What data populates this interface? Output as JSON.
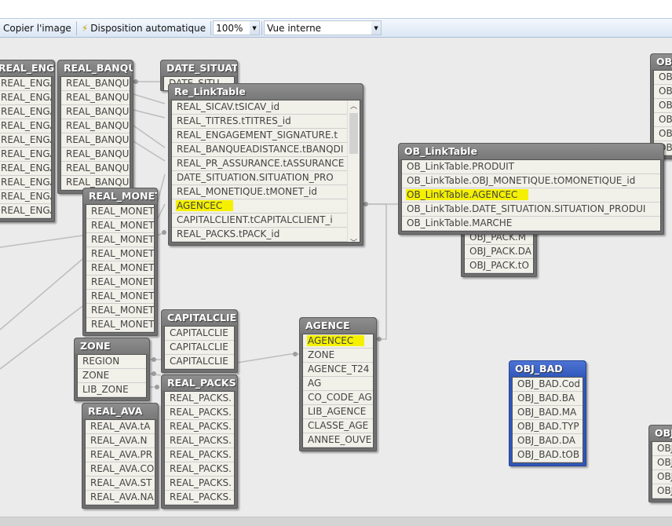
{
  "toolbar": {
    "copy_image_label": "Copier l'image",
    "auto_layout_label": "Disposition automatique",
    "zoom_value": "100%",
    "view_value": "Vue interne"
  },
  "highlight_color": "#f4f000",
  "tables": [
    {
      "name": "REAL_ENGAG",
      "fields": [
        "REAL_ENGAG",
        "REAL_ENGAG",
        "REAL_ENGAG",
        "REAL_ENGAG",
        "REAL_ENGAG",
        "REAL_ENGAG",
        "REAL_ENGAG",
        "REAL_ENGAG",
        "REAL_ENGAG",
        "REAL_ENGAG"
      ]
    },
    {
      "name": "REAL_BANQU",
      "fields": [
        "REAL_BANQU",
        "REAL_BANQU",
        "REAL_BANQU",
        "REAL_BANQU",
        "REAL_BANQU",
        "REAL_BANQU",
        "REAL_BANQU",
        "REAL_BANQU"
      ]
    },
    {
      "name": "DATE_SITUATI",
      "fields": [
        "DATE_SITU"
      ]
    },
    {
      "name": "Re_LinkTable",
      "fields": [
        "REAL_SICAV.tSICAV_id",
        "REAL_TITRES.tTITRES_id",
        "REAL_ENGAGEMENT_SIGNATURE.t",
        "REAL_BANQUEADISTANCE.tBANQDI",
        "REAL_PR_ASSURANCE.tASSURANCE",
        "DATE_SITUATION.SITUATION_PRO",
        "REAL_MONETIQUE.tMONET_id",
        "AGENCEC",
        "CAPITALCLIENT.tCAPITALCLIENT_i",
        "REAL_PACKS.tPACK_id"
      ],
      "highlight": [
        7
      ],
      "scrollbar": true
    },
    {
      "name": "REAL_MONETI",
      "fields": [
        "REAL_MONET",
        "REAL_MONET",
        "REAL_MONET",
        "REAL_MONET",
        "REAL_MONET",
        "REAL_MONET",
        "REAL_MONET",
        "REAL_MONET",
        "REAL_MONET"
      ]
    },
    {
      "name": "OBJ_",
      "fields": [
        "OBJ",
        "OBJ",
        "OBJ",
        "OBJ",
        "OBJ",
        "OBJ"
      ]
    },
    {
      "name": "",
      "fields": [
        "OBJ_PACK.M",
        "OBJ_PACK.DA",
        "OBJ_PACK.tO"
      ]
    },
    {
      "name": "OB_LinkTable",
      "fields": [
        "OB_LinkTable.PRODUIT",
        "OB_LinkTable.OBJ_MONETIQUE.tOMONETIQUE_id",
        "OB_LinkTable.AGENCEC",
        "OB_LinkTable.DATE_SITUATION.SITUATION_PRODUI",
        "OB_LinkTable.MARCHE"
      ],
      "highlight": [
        2
      ]
    },
    {
      "name": "CAPITALCLIEN",
      "fields": [
        "CAPITALCLIE",
        "CAPITALCLIE",
        "CAPITALCLIE"
      ]
    },
    {
      "name": "ZONE",
      "fields": [
        "REGION",
        "ZONE",
        "LIB_ZONE"
      ]
    },
    {
      "name": "REAL_PACKS",
      "fields": [
        "REAL_PACKS.",
        "REAL_PACKS.",
        "REAL_PACKS.",
        "REAL_PACKS.",
        "REAL_PACKS.",
        "REAL_PACKS.",
        "REAL_PACKS.",
        "REAL_PACKS."
      ]
    },
    {
      "name": "REAL_AVA",
      "fields": [
        "REAL_AVA.tA",
        "REAL_AVA.N",
        "REAL_AVA.PR",
        "REAL_AVA.CO",
        "REAL_AVA.ST",
        "REAL_AVA.NA"
      ]
    },
    {
      "name": "AGENCE",
      "fields": [
        "AGENCEC",
        "ZONE",
        "AGENCE_T24",
        "AG",
        "CO_CODE_AG",
        "LIB_AGENCE",
        "CLASSE_AGE",
        "ANNEE_OUVE"
      ],
      "highlight": [
        0
      ]
    },
    {
      "name": "OBJ_BAD",
      "fields": [
        "OBJ_BAD.Cod",
        "OBJ_BAD.BA",
        "OBJ_BAD.MA",
        "OBJ_BAD.TYP",
        "OBJ_BAD.DA",
        "OBJ_BAD.tOB"
      ],
      "selected": true
    },
    {
      "name": "OBJ_",
      "fields": [
        "OBJ",
        "OBJ",
        "OBJ",
        "OBJ"
      ]
    }
  ]
}
